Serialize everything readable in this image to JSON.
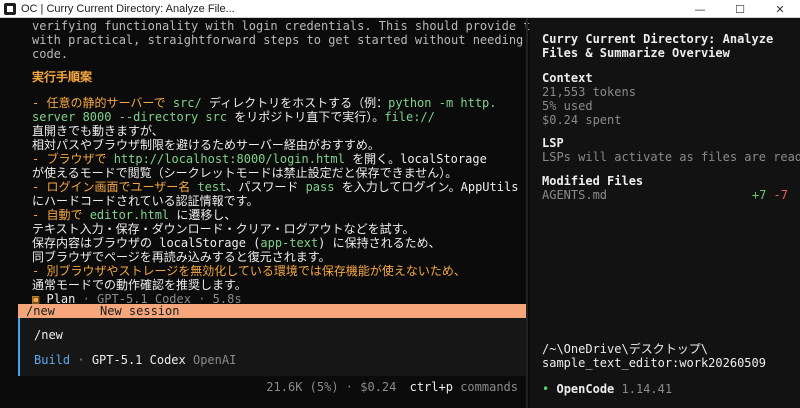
{
  "window": {
    "title": "OC | Curry Current Directory: Analyze File...",
    "controls": {
      "minimize": "—",
      "maximize": "☐",
      "close": "✕"
    }
  },
  "transcript": {
    "intro_lines": [
      "verifying functionality with login credentials. This should provide the user",
      "with practical, straightforward steps to get started without needing to edit",
      "code."
    ],
    "heading": "実行手順案",
    "steps": {
      "s1_a": "- 任意の静的サーバーで ",
      "s1_b": "src/",
      "s1_c": " ディレクトリをホストする（例：",
      "s1_d": "python -m http.",
      "s1_e": "server 8000 --directory src",
      "s1_f": " をリポジトリ直下で実行）。",
      "s1_g": "file://",
      "s1_h": "直開きでも動きますが、",
      "s1_i": "相対パスやブラウザ制限を避けるためサーバー経由がおすすめ。",
      "s2_a": "- ブラウザで ",
      "s2_b": "http://localhost:8000/login.html",
      "s2_c": " を開く。localStorage",
      "s2_d": "が使えるモードで閲覧（シークレットモードは禁止設定だと保存できません）。",
      "s3_a": "- ログイン画面でユーザー名 ",
      "s3_b": "test",
      "s3_c": "、パスワード ",
      "s3_d": "pass",
      "s3_e": " を入力してログイン。AppUtils",
      "s3_f": "にハードコードされている認証情報です。",
      "s4_a": "- 自動で ",
      "s4_b": "editor.html",
      "s4_c": " に遷移し、",
      "s4_d": "テキスト入力・保存・ダウンロード・クリア・ログアウトなどを試す。",
      "s4_e": "保存内容はブラウザの localStorage (",
      "s4_f": "app-text",
      "s4_g": ") に保持されるため、",
      "s4_h": "同ブラウザでページを再読み込みすると復元されます。",
      "s5_a": "- 別ブラウザやストレージを無効化している環境では保存機能が使えないため、",
      "s5_b": "通常モードでの動作確認を推奨します。"
    },
    "plan": {
      "icon": "▣",
      "label": "Plan",
      "meta": "· GPT-5.1 Codex · 5.8s"
    }
  },
  "autocomplete": {
    "command": "/new",
    "description": "New session"
  },
  "input": {
    "value": "/new",
    "agent": "Build",
    "model": "GPT-5.1 Codex",
    "provider": "OpenAI"
  },
  "status": {
    "tokens": "21.6K (5%)",
    "cost": "$0.24",
    "shortcut": "ctrl+p",
    "shortcut_label": "commands"
  },
  "sidebar": {
    "title_line1": "Curry Current Directory: Analyze",
    "title_line2": "Files & Summarize Overview",
    "context": {
      "heading": "Context",
      "tokens": "21,553 tokens",
      "used": "5% used",
      "spent": "$0.24 spent"
    },
    "lsp": {
      "heading": "LSP",
      "message": "LSPs will activate as files are read"
    },
    "modified": {
      "heading": "Modified Files",
      "file": "AGENTS.md",
      "added": "+7",
      "removed": "-7"
    },
    "path_line1": "/~\\OneDrive\\デスクトップ\\",
    "path_line2": "sample_text_editor:work20260509",
    "app": {
      "dot": "•",
      "name": "OpenCode",
      "version": "1.14.41"
    }
  },
  "colors": {
    "accent_orange": "#f5a742",
    "autocomplete_bg": "#f5a77b",
    "code_green": "#7fd18b",
    "input_border": "#4aa3e8",
    "diff_add": "#5fcf6b",
    "diff_del": "#e85b5b"
  }
}
